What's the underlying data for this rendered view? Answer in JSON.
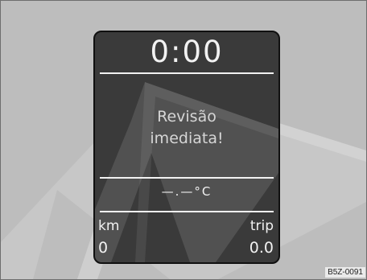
{
  "display": {
    "clock": "0:00",
    "message_line1": "Revisão",
    "message_line2": "imediata!",
    "temperature": "—.—°C",
    "left_label": "km",
    "left_value": "0",
    "right_label": "trip",
    "right_value": "0.0"
  },
  "image_code": "B5Z-0091",
  "colors": {
    "background": "#bdbdbd",
    "display": "#3a3a3a",
    "text": "#f2f2f2"
  }
}
